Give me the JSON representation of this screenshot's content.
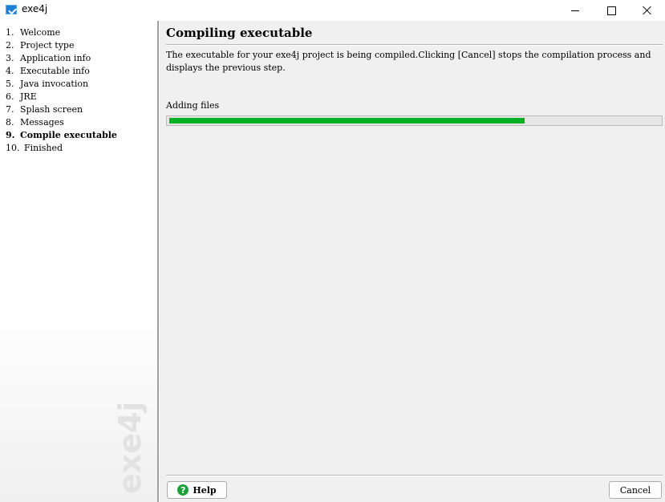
{
  "window": {
    "title": "exe4j",
    "app_icon": "exe4j-app-icon",
    "controls": [
      "minimize-icon",
      "maximize-icon",
      "close-icon"
    ]
  },
  "sidebar": {
    "steps": [
      {
        "num": "1.",
        "label": "Welcome"
      },
      {
        "num": "2.",
        "label": "Project type"
      },
      {
        "num": "3.",
        "label": "Application info"
      },
      {
        "num": "4.",
        "label": "Executable info"
      },
      {
        "num": "5.",
        "label": "Java invocation"
      },
      {
        "num": "6.",
        "label": "JRE"
      },
      {
        "num": "7.",
        "label": "Splash screen"
      },
      {
        "num": "8.",
        "label": "Messages"
      },
      {
        "num": "9.",
        "label": "Compile executable"
      },
      {
        "num": "10.",
        "label": "Finished"
      }
    ],
    "active_step": 9,
    "watermark": "exe4j"
  },
  "main": {
    "title": "Compiling executable",
    "description": "The executable for your exe4j project is being compiled.Clicking [Cancel] stops the compilation process and displays the previous step.",
    "status_label": "Adding files",
    "progress_fraction": 0.725,
    "progress_color": "#06b025"
  },
  "buttons": {
    "help_label": "Help",
    "help_icon": "question-mark-icon",
    "cancel_label": "Cancel"
  }
}
